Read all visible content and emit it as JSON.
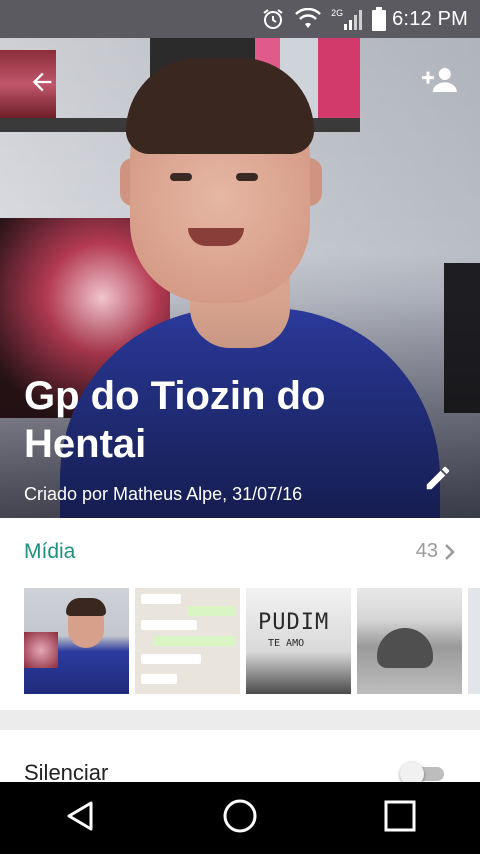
{
  "status_bar": {
    "time": "6:12 PM",
    "network": "2G",
    "icons": [
      "alarm-icon",
      "wifi-icon",
      "signal-icon",
      "battery-icon"
    ]
  },
  "header": {
    "title": "Gp do Tiozin do Hentai",
    "subtitle": "Criado por Matheus Alpe, 31/07/16",
    "icons": [
      "back-arrow-icon",
      "add-participant-icon",
      "edit-pencil-icon"
    ]
  },
  "media": {
    "label": "Mídia",
    "count": "43",
    "thumb_texts": {
      "graffiti": "PUDIM",
      "graffiti_small": "TE AMO"
    },
    "accent_color": "#1f8f7e"
  },
  "settings": {
    "mute_label": "Silenciar",
    "mute_enabled": false
  },
  "nav": {
    "buttons": [
      "back-triangle-icon",
      "home-circle-icon",
      "recents-square-icon"
    ]
  }
}
